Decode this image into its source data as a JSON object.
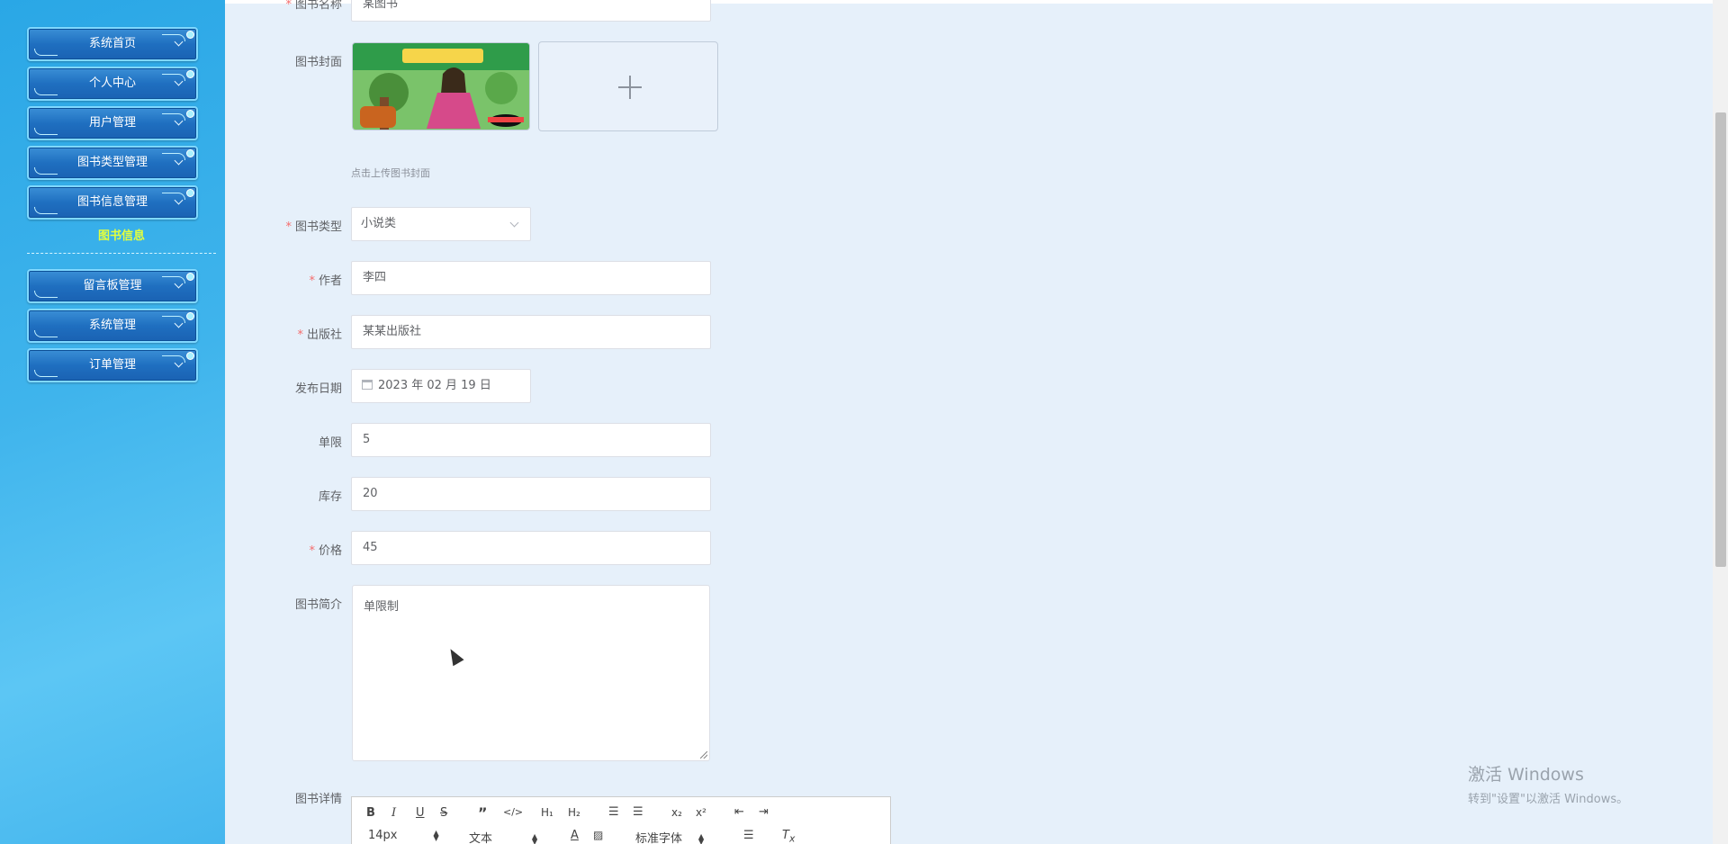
{
  "sidebar": {
    "items": [
      {
        "label": "系统首页"
      },
      {
        "label": "个人中心"
      },
      {
        "label": "用户管理"
      },
      {
        "label": "图书类型管理"
      },
      {
        "label": "图书信息管理"
      },
      {
        "label": "留言板管理"
      },
      {
        "label": "系统管理"
      },
      {
        "label": "订单管理"
      }
    ],
    "submenu_label": "图书信息"
  },
  "form": {
    "name": {
      "label": "图书名称",
      "value": "某图书"
    },
    "cover": {
      "label": "图书封面",
      "tip": "点击上传图书封面"
    },
    "type": {
      "label": "图书类型",
      "value": "小说类"
    },
    "author": {
      "label": "作者",
      "value": "李四"
    },
    "publisher": {
      "label": "出版社",
      "value": "某某出版社"
    },
    "publish_date": {
      "label": "发布日期",
      "value": "2023 年 02 月 19 日"
    },
    "limit": {
      "label": "单限",
      "value": "5"
    },
    "stock": {
      "label": "库存",
      "value": "20"
    },
    "price": {
      "label": "价格",
      "value": "45"
    },
    "intro": {
      "label": "图书简介",
      "value": "单限制"
    },
    "detail": {
      "label": "图书详情"
    }
  },
  "editor": {
    "font_size": "14px",
    "text_style": "文本",
    "font_family": "标准字体"
  },
  "watermark": {
    "line1": "激活 Windows",
    "line2": "转到\"设置\"以激活 Windows。"
  },
  "colors": {
    "sidebar_bg": "#3fb4ec",
    "menu_button": "#1f6fc0",
    "submenu_active": "#e4ff3c",
    "content_bg": "#e6f0fa",
    "required_star": "#f56c6c"
  }
}
